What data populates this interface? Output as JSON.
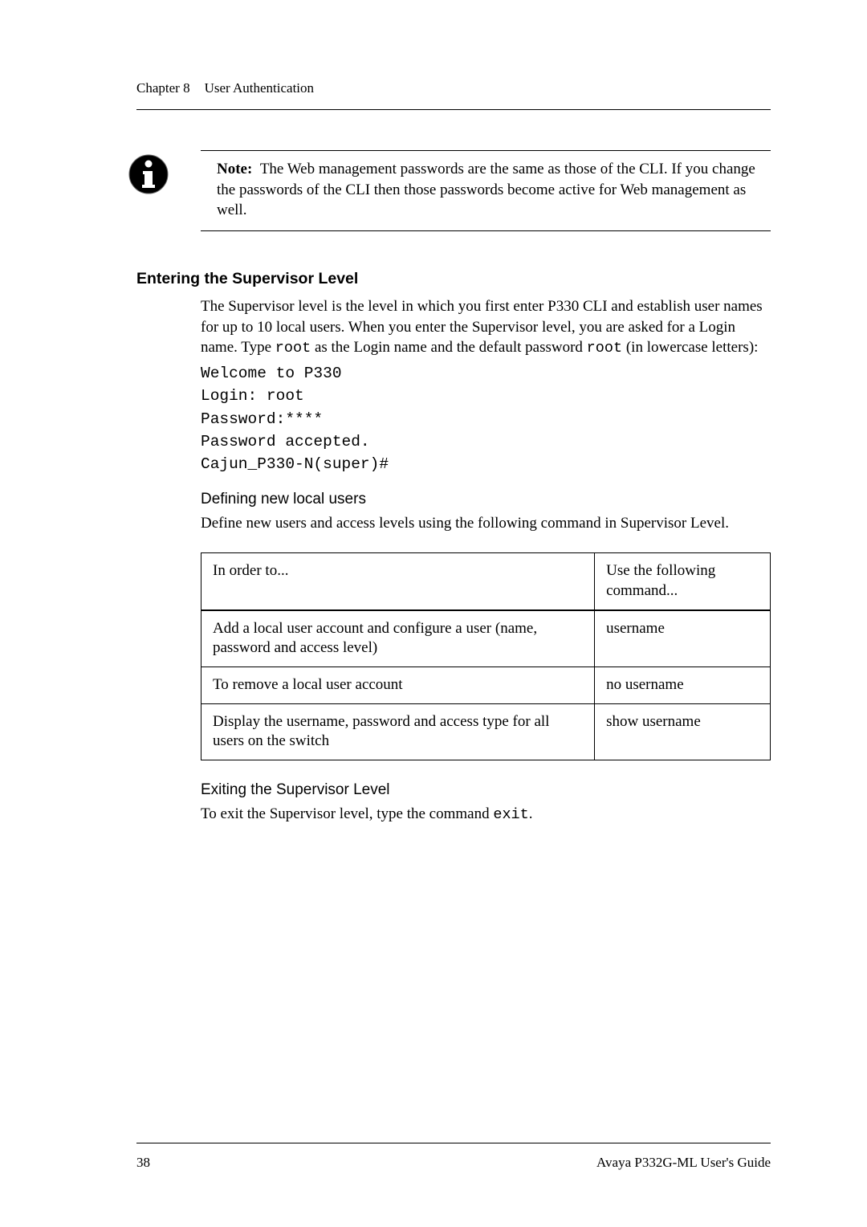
{
  "header": {
    "chapter": "Chapter 8",
    "title": "User Authentication"
  },
  "note": {
    "label": "Note:",
    "text": "The Web management passwords are the same as those of the CLI. If you change the passwords of the CLI then those passwords become active for Web management as well."
  },
  "section1": {
    "heading": "Entering the Supervisor Level",
    "para1_a": "The Supervisor level is the level in which you first enter P330 CLI and establish user names for up to 10 local users. When you enter the Supervisor level, you are asked for a Login name. Type ",
    "code_root1": "root",
    "para1_b": " as the Login name and the default password ",
    "code_root2": "root",
    "para1_c": " (in lowercase letters):",
    "code": [
      "Welcome to P330",
      "Login: root",
      "Password:****",
      "Password accepted.",
      "Cajun_P330-N(super)#"
    ]
  },
  "sub1": {
    "heading": "Defining new local users",
    "para": "Define new users and access levels using the following command in Supervisor Level."
  },
  "table": {
    "head": [
      "In order to...",
      "Use the following command..."
    ],
    "rows": [
      [
        "Add a local user account and configure a user (name, password and access level)",
        "username"
      ],
      [
        "To remove a local user account",
        "no username"
      ],
      [
        "Display the username, password and access type for all users on the switch",
        "show username"
      ]
    ]
  },
  "sub2": {
    "heading": "Exiting the Supervisor Level",
    "para_a": "To exit the Supervisor level, type the command ",
    "code_exit": "exit",
    "para_b": "."
  },
  "footer": {
    "page": "38",
    "doc": "Avaya P332G-ML User's Guide"
  }
}
